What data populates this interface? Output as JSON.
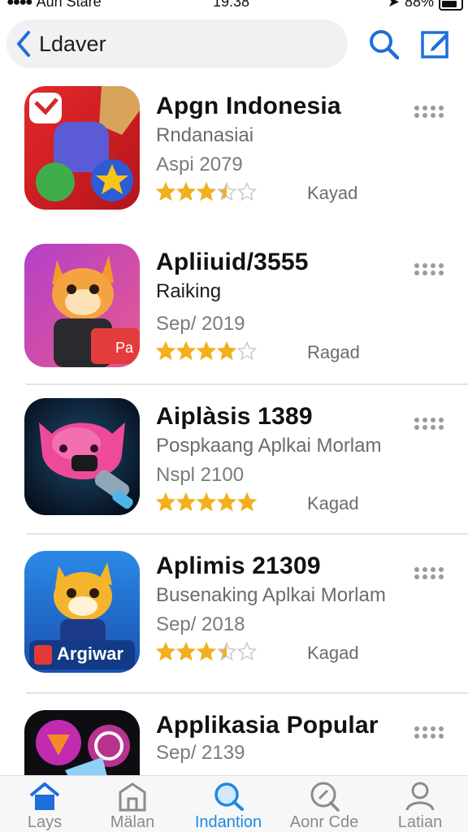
{
  "status_bar": {
    "carrier": "Auri Stare",
    "time": "19:38",
    "battery": "88%"
  },
  "header": {
    "back_label": "Ldaver",
    "icons": [
      "chevron-left-icon",
      "search-icon",
      "compose-icon"
    ]
  },
  "apps": [
    {
      "title": "Apgn Indonesia",
      "subtitle": "Rndanasiai",
      "date": "Aspi 2079",
      "rating": 3.5,
      "rating_label": "Kayad",
      "icon": "shapes-app-icon"
    },
    {
      "title": "Apliiuid/3555",
      "subtitle": "Raiking",
      "date": "Sep/ 2019",
      "rating": 4,
      "rating_label": "Ragad",
      "icon": "fox-mascot-app-icon"
    },
    {
      "title": "Aiplàsis 1389",
      "subtitle": "Pospkaang Aplkai Morlam",
      "date": "Nspl 2100",
      "rating": 5,
      "rating_label": "Kagad",
      "icon": "pink-creature-app-icon"
    },
    {
      "title": "Aplimis 21309",
      "subtitle": "Busenaking Aplkai Morlam",
      "date": "Sep/ 2018",
      "rating": 3.5,
      "rating_label": "Kagad",
      "icon": "tiger-mascot-app-icon",
      "icon_text": "Argiwar"
    },
    {
      "title": "Applikasia Popular",
      "subtitle": "",
      "date": "Sep/ 2139",
      "icon": "dark-shapes-app-icon"
    }
  ],
  "tabs": [
    {
      "label": "Lays",
      "icon": "home-icon",
      "active": false
    },
    {
      "label": "Mälan",
      "icon": "store-icon",
      "active": false
    },
    {
      "label": "Indantion",
      "icon": "search-icon",
      "active": true
    },
    {
      "label": "Aonr Cde",
      "icon": "magnifier-icon",
      "active": false
    },
    {
      "label": "Latian",
      "icon": "person-icon",
      "active": false
    }
  ],
  "colors": {
    "accent": "#1e88e5",
    "star": "#f2b01e",
    "star_empty": "#c7c7cc",
    "divider": "#e2e2e6"
  }
}
